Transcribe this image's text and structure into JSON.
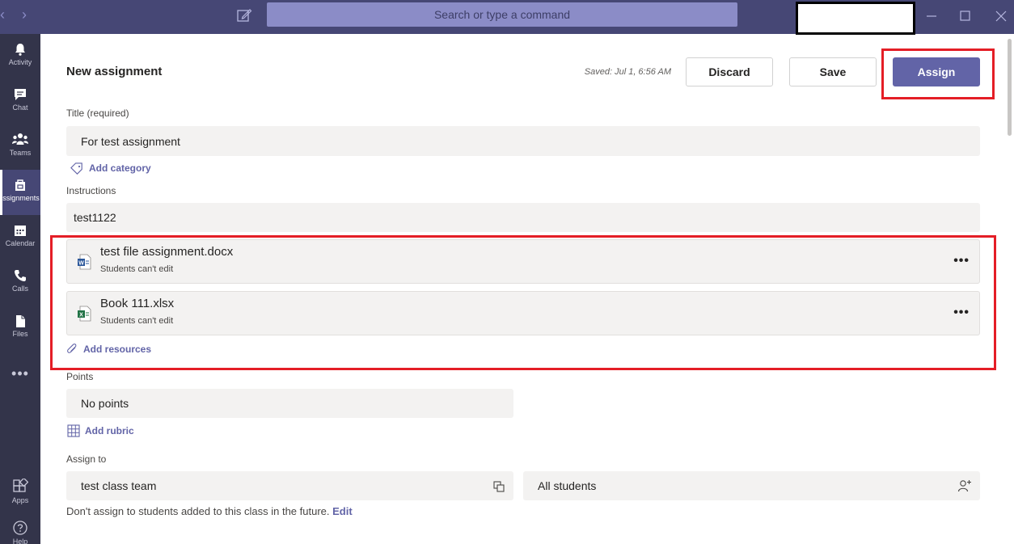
{
  "search": {
    "placeholder": "Search or type a command"
  },
  "rail": {
    "items": [
      {
        "label": "Activity",
        "icon": "bell-icon"
      },
      {
        "label": "Chat",
        "icon": "chat-icon"
      },
      {
        "label": "Teams",
        "icon": "teams-icon"
      },
      {
        "label": "Assignments",
        "icon": "assignments-icon"
      },
      {
        "label": "Calendar",
        "icon": "calendar-icon"
      },
      {
        "label": "Calls",
        "icon": "phone-icon"
      },
      {
        "label": "Files",
        "icon": "file-icon"
      }
    ],
    "more": "•••",
    "apps": "Apps",
    "help": "Help"
  },
  "header": {
    "title": "New assignment",
    "saved": "Saved: Jul 1, 6:56 AM",
    "discard": "Discard",
    "save": "Save",
    "assign": "Assign"
  },
  "form": {
    "title_label": "Title (required)",
    "title_value": "For test assignment",
    "add_category": "Add category",
    "instructions_label": "Instructions",
    "instructions_value": "test1122",
    "attachments": [
      {
        "name": "test file assignment.docx",
        "permission": "Students can't edit",
        "type": "word"
      },
      {
        "name": "Book 111.xlsx",
        "permission": "Students can't edit",
        "type": "excel"
      }
    ],
    "add_resources": "Add resources",
    "points_label": "Points",
    "points_value": "No points",
    "add_rubric": "Add rubric",
    "assign_to_label": "Assign to",
    "class_value": "test class team",
    "students_value": "All students",
    "future_note": "Don't assign to students added to this class in the future.",
    "edit_link": "Edit"
  },
  "colors": {
    "accent": "#6264a7",
    "titlebar": "#464775",
    "rail": "#33344a",
    "highlight": "#e41e26"
  }
}
